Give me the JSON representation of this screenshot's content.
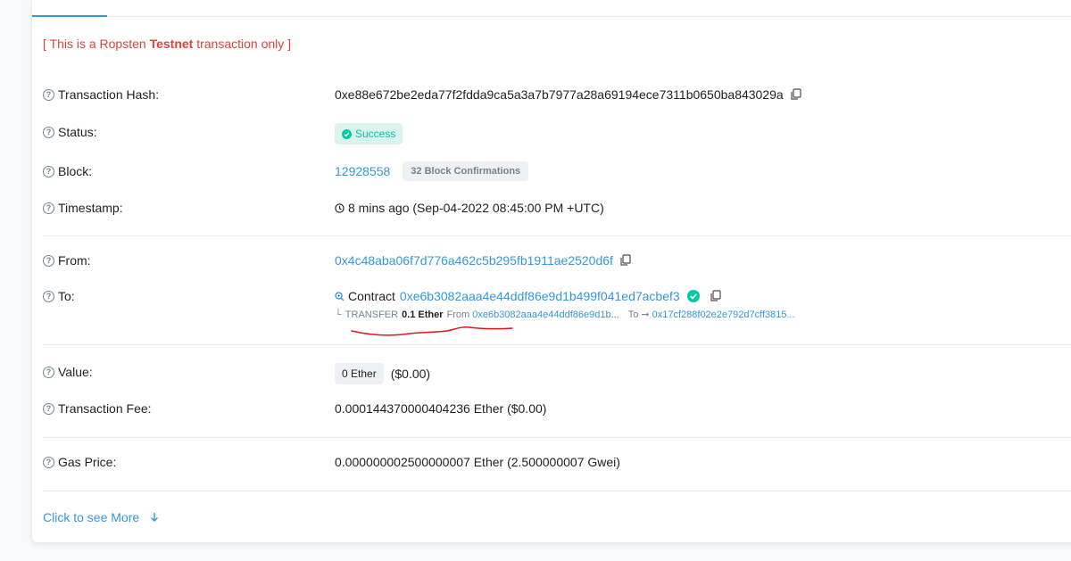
{
  "notice": {
    "prefix": "[ This is a Ropsten ",
    "bold": "Testnet",
    "suffix": " transaction only ]"
  },
  "fields": {
    "tx_hash": {
      "label": "Transaction Hash:",
      "value": "0xe88e672be2eda77f2fdda9ca5a3a7b7977a28a69194ece7311b0650ba843029a"
    },
    "status": {
      "label": "Status:",
      "value": "Success"
    },
    "block": {
      "label": "Block:",
      "value": "12928558",
      "confirmations": "32 Block Confirmations"
    },
    "timestamp": {
      "label": "Timestamp:",
      "value": "8 mins ago (Sep-04-2022 08:45:00 PM +UTC)"
    },
    "from": {
      "label": "From:",
      "value": "0x4c48aba06f7d776a462c5b295fb1911ae2520d6f"
    },
    "to": {
      "label": "To:",
      "contract_prefix": "Contract",
      "value": "0xe6b3082aaa4e44ddf86e9d1b499f041ed7acbef3",
      "transfer": {
        "kind": "TRANSFER",
        "amount": "0.1 Ether",
        "from_label": "From",
        "from_addr": "0xe6b3082aaa4e44ddf86e9d1b...",
        "to_label": "To",
        "to_addr": "0x17cf288f02e2e792d7cff3815..."
      }
    },
    "value": {
      "label": "Value:",
      "badge": "0 Ether",
      "usd": "($0.00)"
    },
    "fee": {
      "label": "Transaction Fee:",
      "value": "0.000144370000404236 Ether ($0.00)"
    },
    "gas_price": {
      "label": "Gas Price:",
      "value": "0.000000002500000007 Ether (2.500000007 Gwei)"
    }
  },
  "see_more": "Click to see More",
  "colors": {
    "link": "#3498db",
    "notice": "#de4437",
    "success": "#00c9a7",
    "annotation": "#e8121a"
  }
}
